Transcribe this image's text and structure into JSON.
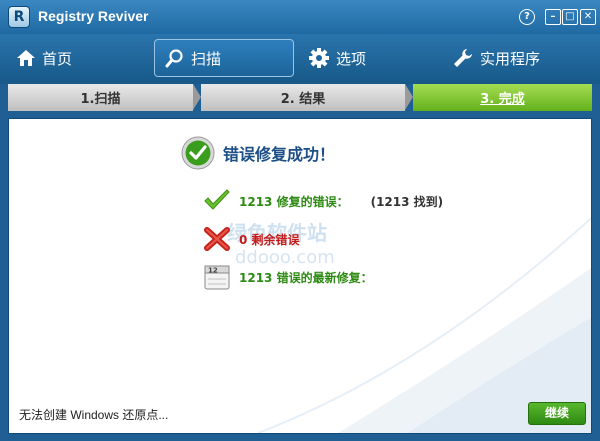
{
  "window": {
    "title": "Registry Reviver",
    "logo_letter": "R",
    "help_glyph": "?",
    "min_glyph": "–",
    "max_glyph": "□",
    "close_glyph": "✕"
  },
  "nav": {
    "items": [
      {
        "label": "首页",
        "icon": "home-icon"
      },
      {
        "label": "扫描",
        "icon": "search-icon",
        "active": true
      },
      {
        "label": "选项",
        "icon": "gear-icon"
      },
      {
        "label": "实用程序",
        "icon": "wrench-icon"
      }
    ]
  },
  "steps": [
    {
      "label": "1.扫描"
    },
    {
      "label": "2. 结果"
    },
    {
      "label": "3. 完成",
      "current": true
    }
  ],
  "content": {
    "success_title": "错误修复成功！",
    "results": [
      {
        "text": "1213 修复的错误：",
        "extra": "(1213 找到)",
        "icon": "check-icon"
      },
      {
        "text": "0 剩余错误",
        "icon": "red-x-icon"
      },
      {
        "text": "1213 错误的最新修复：",
        "icon": "calendar-icon",
        "calendar_day": "12"
      }
    ],
    "watermark_line1": "绿色软件站",
    "watermark_line2": "ddooo.com",
    "status_text": "无法创建 Windows 还原点...",
    "continue_label": "继续"
  },
  "colors": {
    "frame": "#1f5f93",
    "accent_green": "#63b11c",
    "error_red": "#c51a1a",
    "title_blue": "#1d4f86"
  }
}
